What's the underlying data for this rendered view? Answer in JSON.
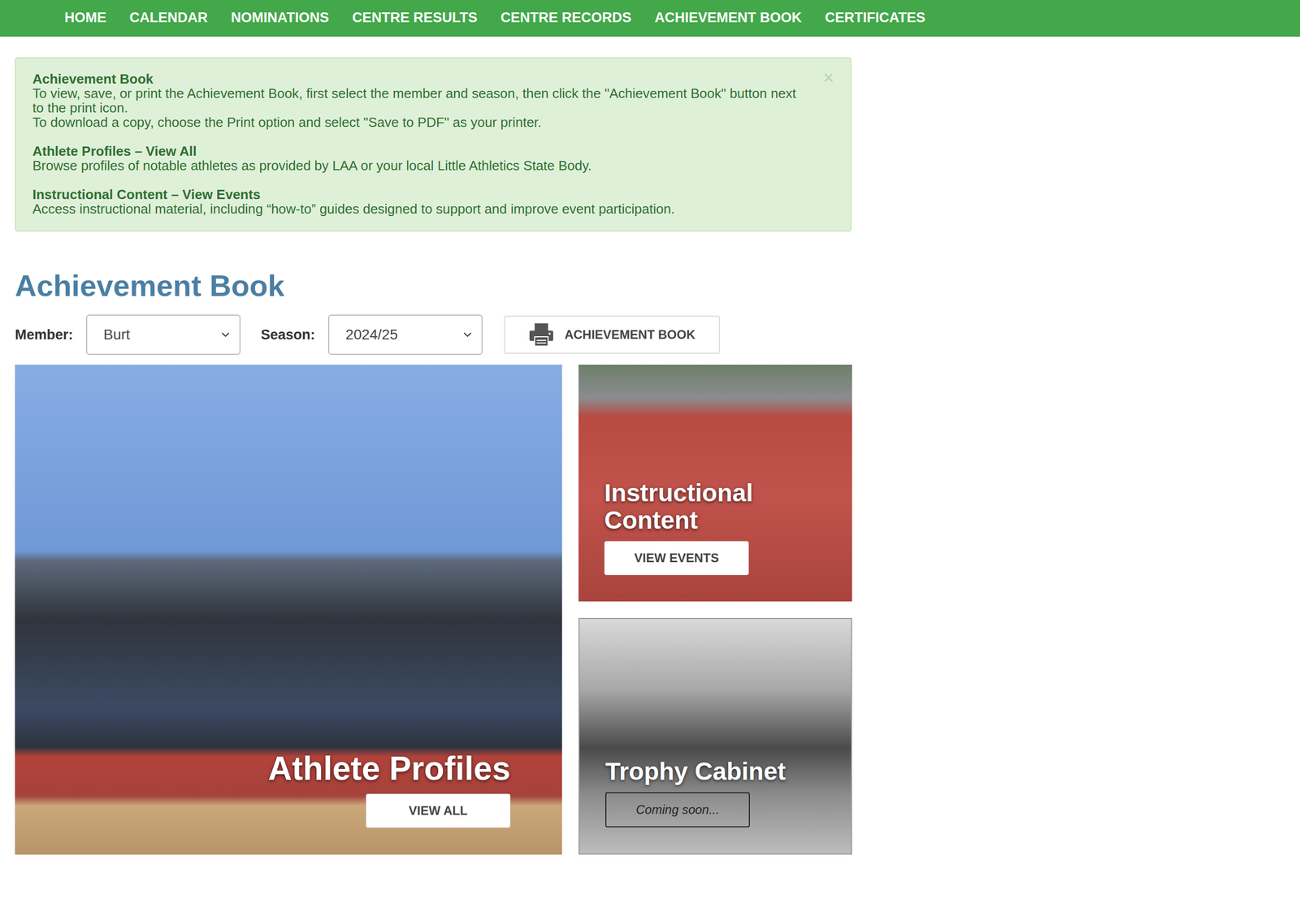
{
  "nav": {
    "items": [
      {
        "label": "HOME"
      },
      {
        "label": "CALENDAR"
      },
      {
        "label": "NOMINATIONS"
      },
      {
        "label": "CENTRE RESULTS"
      },
      {
        "label": "CENTRE RECORDS"
      },
      {
        "label": "ACHIEVEMENT BOOK"
      },
      {
        "label": "CERTIFICATES"
      }
    ]
  },
  "alert": {
    "close": "×",
    "sections": [
      {
        "title": "Achievement Book",
        "lines": [
          "To view, save, or print the Achievement Book, first select the member and season, then click the \"Achievement Book\" button next to the print icon.",
          "To download a copy, choose the Print option and select \"Save to PDF\" as your printer."
        ]
      },
      {
        "title": "Athlete Profiles – View All",
        "lines": [
          "Browse profiles of notable athletes as provided by LAA or your local Little Athletics State Body."
        ]
      },
      {
        "title": "Instructional Content – View Events",
        "lines": [
          "Access instructional material, including “how-to” guides designed to support and improve event participation."
        ]
      }
    ]
  },
  "heading": "Achievement Book",
  "member": {
    "label": "Member:",
    "value": "Burt"
  },
  "season": {
    "label": "Season:",
    "value": "2024/25"
  },
  "print_button": {
    "label": "ACHIEVEMENT BOOK"
  },
  "tiles": [
    {
      "kind": "profiles",
      "title": "Athlete Profiles",
      "button": "VIEW ALL",
      "disabled": false
    },
    {
      "kind": "instructional",
      "title": "Instructional Content",
      "button": "VIEW EVENTS",
      "disabled": false
    },
    {
      "kind": "trophy",
      "title": "Trophy Cabinet",
      "button": "Coming soon...",
      "disabled": true
    }
  ]
}
